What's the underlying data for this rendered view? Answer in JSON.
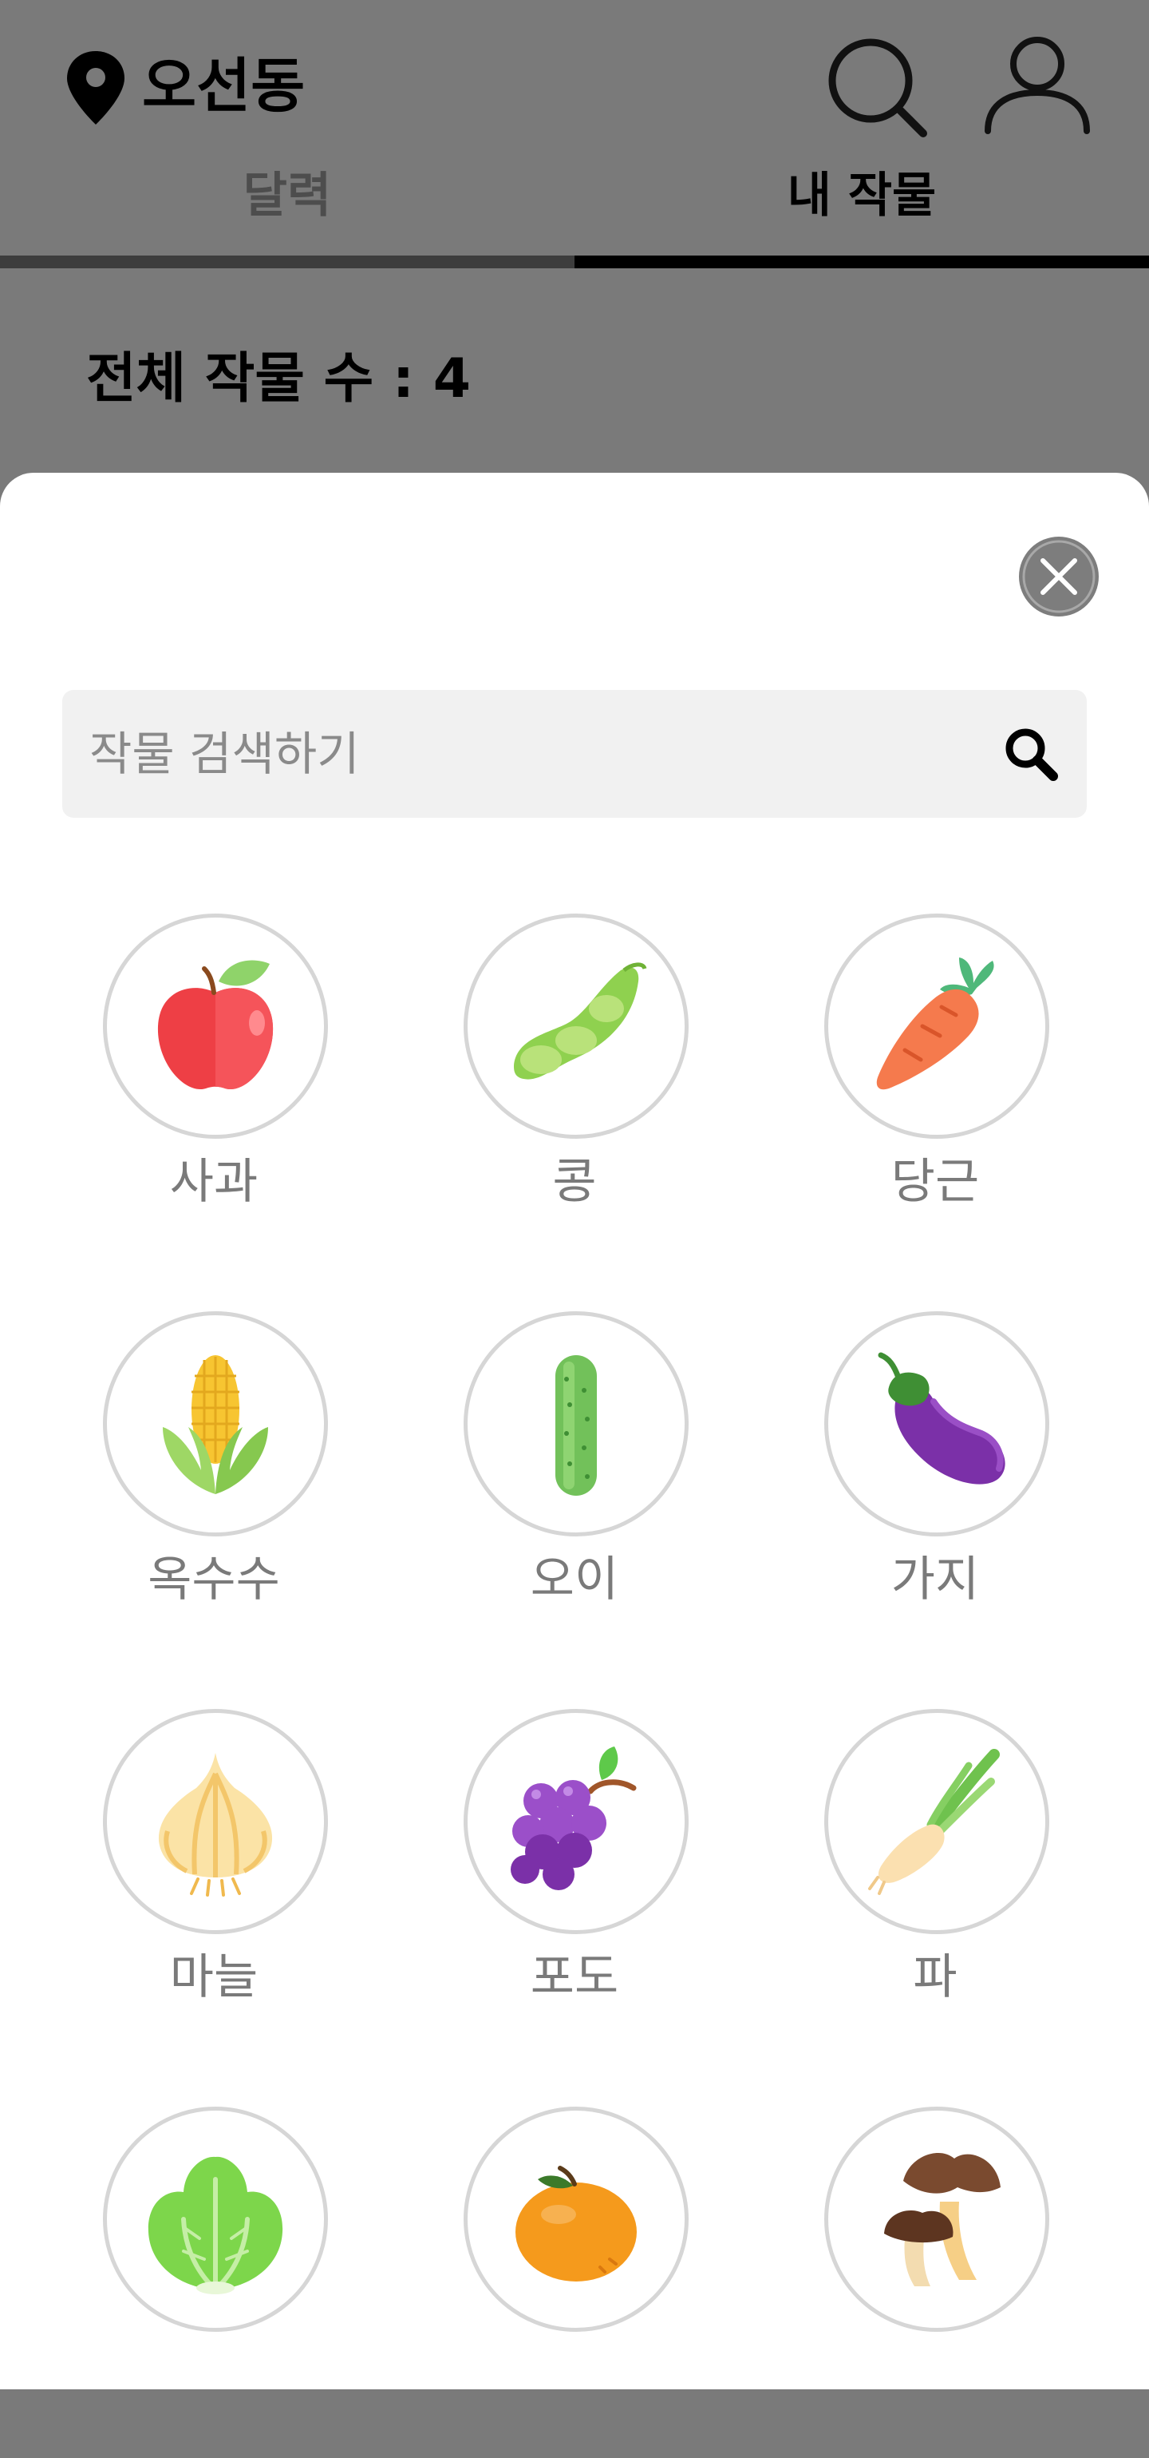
{
  "header": {
    "location": "오선동",
    "tabs": {
      "calendar": "달력",
      "my_crops": "내 작물"
    },
    "active_tab": "my_crops"
  },
  "summary": {
    "total_crops": "전체 작물 수 : 4"
  },
  "sheet": {
    "search_placeholder": "작물 검색하기",
    "search_value": "",
    "crops": [
      {
        "label": "사과",
        "icon": "apple-icon"
      },
      {
        "label": "콩",
        "icon": "bean-icon"
      },
      {
        "label": "당근",
        "icon": "carrot-icon"
      },
      {
        "label": "옥수수",
        "icon": "corn-icon"
      },
      {
        "label": "오이",
        "icon": "cucumber-icon"
      },
      {
        "label": "가지",
        "icon": "eggplant-icon"
      },
      {
        "label": "마늘",
        "icon": "garlic-icon"
      },
      {
        "label": "포도",
        "icon": "grape-icon"
      },
      {
        "label": "파",
        "icon": "green-onion-icon"
      },
      {
        "label": "",
        "icon": "lettuce-icon"
      },
      {
        "label": "",
        "icon": "tangerine-icon"
      },
      {
        "label": "",
        "icon": "mushroom-icon"
      }
    ]
  },
  "colors": {
    "overlay": "#7a7a7a",
    "sheet_bg": "#ffffff",
    "search_bg": "#f1f1f1",
    "circle_border": "#d6d6d6",
    "label_text": "#7a7a7a"
  }
}
